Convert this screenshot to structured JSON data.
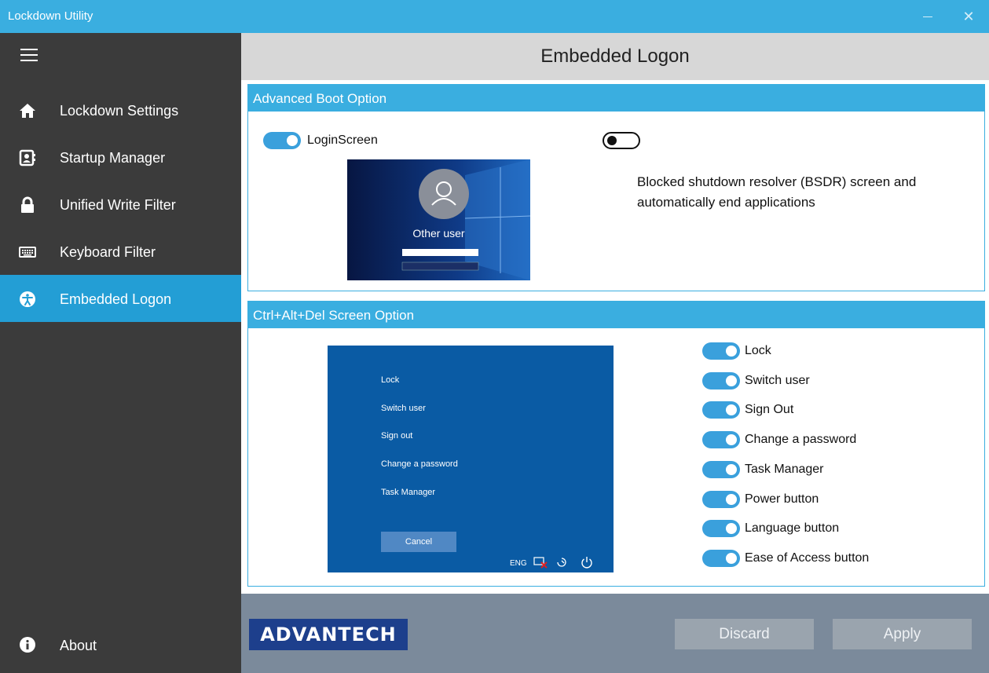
{
  "window": {
    "title": "Lockdown Utility",
    "minimize": "—",
    "close": "✕"
  },
  "sidebar": {
    "items": [
      {
        "label": "Lockdown Settings",
        "icon": "home-icon"
      },
      {
        "label": "Startup Manager",
        "icon": "contact-card-icon"
      },
      {
        "label": "Unified Write Filter",
        "icon": "lock-icon"
      },
      {
        "label": "Keyboard Filter",
        "icon": "keyboard-icon"
      },
      {
        "label": "Embedded Logon",
        "icon": "accessibility-icon",
        "active": true
      }
    ],
    "about": "About"
  },
  "header": {
    "title": "Embedded Logon"
  },
  "advanced_boot": {
    "title": "Advanced Boot Option",
    "login_screen": {
      "label": "LoginScreen",
      "on": true
    },
    "bsdr": {
      "on": false,
      "description": "Blocked shutdown resolver (BSDR) screen and automatically end applications"
    },
    "preview": {
      "user": "Other user"
    }
  },
  "cad": {
    "title": "Ctrl+Alt+Del Screen Option",
    "preview": {
      "items": [
        "Lock",
        "Switch user",
        "Sign out",
        "Change a password",
        "Task Manager"
      ],
      "cancel": "Cancel",
      "lang": "ENG"
    },
    "options": [
      {
        "label": "Lock",
        "on": true
      },
      {
        "label": "Switch user",
        "on": true
      },
      {
        "label": "Sign Out",
        "on": true
      },
      {
        "label": "Change a password",
        "on": true
      },
      {
        "label": "Task Manager",
        "on": true
      },
      {
        "label": "Power button",
        "on": true
      },
      {
        "label": "Language button",
        "on": true
      },
      {
        "label": "Ease of Access button",
        "on": true
      }
    ]
  },
  "footer": {
    "brand": "ADVANTECH",
    "discard": "Discard",
    "apply": "Apply"
  },
  "colors": {
    "accent": "#3aaee0",
    "sidebar": "#3b3b3b",
    "active": "#239ed5",
    "toggle": "#3aa0dc"
  }
}
